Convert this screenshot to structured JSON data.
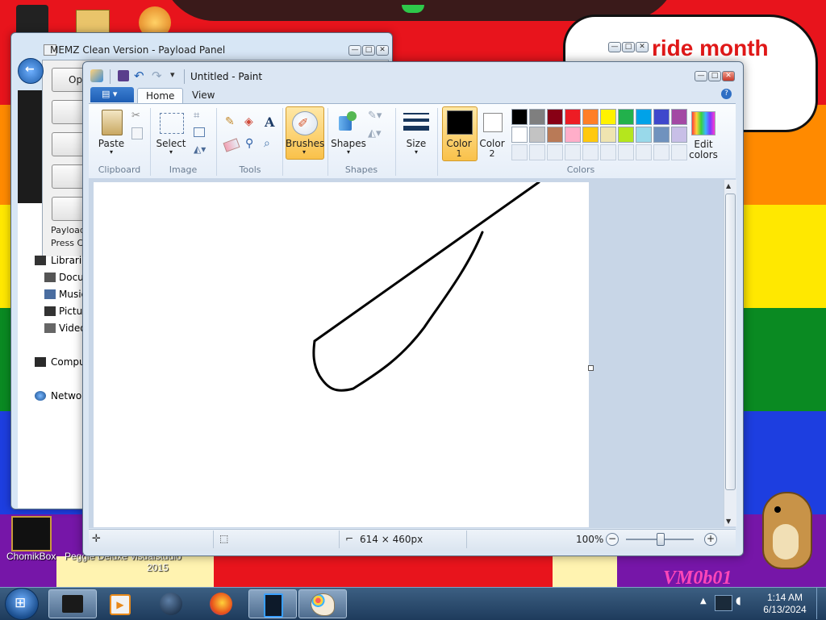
{
  "desktop": {
    "speech_text": "ride month",
    "watermark": "VM0b01",
    "icons": [
      {
        "label": "ChomikBox"
      },
      {
        "label": "Peggle Deluxe"
      },
      {
        "label": "visualstudio"
      },
      {
        "label": "2015"
      }
    ]
  },
  "memz": {
    "title": "MEMZ Clean Version - Payload Panel",
    "open_label": "Ope",
    "payloads_text": "Payloads",
    "press_text": "Press CT"
  },
  "explorer": {
    "items": [
      {
        "label": "Librarie"
      },
      {
        "label": "Docu"
      },
      {
        "label": "Music"
      },
      {
        "label": "Pictur"
      },
      {
        "label": "Video"
      },
      {
        "label": "Compu"
      },
      {
        "label": "Networ"
      }
    ]
  },
  "paint": {
    "title": "Untitled - Paint",
    "tabs": {
      "home": "Home",
      "view": "View"
    },
    "groups": {
      "clipboard": "Clipboard",
      "image": "Image",
      "tools": "Tools",
      "shapes": "Shapes",
      "colors": "Colors"
    },
    "buttons": {
      "paste": "Paste",
      "select": "Select",
      "brushes": "Brushes",
      "shapes": "Shapes",
      "size": "Size",
      "color1": "Color",
      "color1_num": "1",
      "color2": "Color",
      "color2_num": "2",
      "edit_colors_1": "Edit",
      "edit_colors_2": "colors"
    },
    "palette_row1": [
      "#000000",
      "#7f7f7f",
      "#880015",
      "#ed1c24",
      "#ff7f27",
      "#fff200",
      "#22b14c",
      "#00a2e8",
      "#3f48cc",
      "#a349a4"
    ],
    "palette_row2": [
      "#ffffff",
      "#c3c3c3",
      "#b97a57",
      "#ffaec9",
      "#ffc90e",
      "#efe4b0",
      "#b5e61d",
      "#99d9ea",
      "#7092be",
      "#c8bfe7"
    ],
    "color1_value": "#000000",
    "color2_value": "#ffffff",
    "status": {
      "dimensions": "614 × 460px",
      "zoom": "100%"
    }
  },
  "taskbar": {
    "time": "1:14 AM",
    "date": "6/13/2024"
  }
}
